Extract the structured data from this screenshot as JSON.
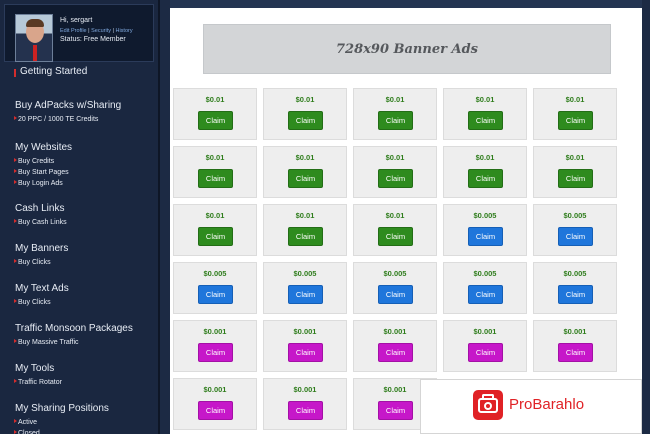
{
  "profile": {
    "greeting": "Hi, sergart",
    "links": [
      "Edit Profile",
      "Security",
      "History"
    ],
    "status": "Status: Free Member"
  },
  "menu": [
    {
      "title": "Getting Started",
      "marked": true,
      "items": []
    },
    {
      "title": "Buy AdPacks w/Sharing",
      "marked": false,
      "items": [
        "20 PPC / 1000 TE Credits"
      ]
    },
    {
      "title": "My Websites",
      "marked": false,
      "items": [
        "Buy Credits",
        "Buy Start Pages",
        "Buy Login Ads"
      ]
    },
    {
      "title": "Cash Links",
      "marked": false,
      "items": [
        "Buy Cash Links"
      ]
    },
    {
      "title": "My Banners",
      "marked": false,
      "items": [
        "Buy Clicks"
      ]
    },
    {
      "title": "My Text Ads",
      "marked": false,
      "items": [
        "Buy Clicks"
      ]
    },
    {
      "title": "Traffic Monsoon Packages",
      "marked": false,
      "items": [
        "Buy Massive Traffic"
      ]
    },
    {
      "title": "My Tools",
      "marked": false,
      "items": [
        "Traffic Rotator"
      ]
    },
    {
      "title": "My Sharing Positions",
      "marked": false,
      "items": [
        "Active",
        "Closed"
      ]
    }
  ],
  "banner": {
    "text": "728x90 Banner Ads"
  },
  "claim_label": "Claim",
  "colors": {
    "green": "#2e8b1e",
    "blue": "#1f76db",
    "magenta": "#c617c9",
    "sidebar": "#1a2740"
  },
  "ads": [
    [
      {
        "amount": "$0.01",
        "color": "green"
      },
      {
        "amount": "$0.01",
        "color": "green"
      },
      {
        "amount": "$0.01",
        "color": "green"
      },
      {
        "amount": "$0.01",
        "color": "green"
      },
      {
        "amount": "$0.01",
        "color": "green"
      }
    ],
    [
      {
        "amount": "$0.01",
        "color": "green"
      },
      {
        "amount": "$0.01",
        "color": "green"
      },
      {
        "amount": "$0.01",
        "color": "green"
      },
      {
        "amount": "$0.01",
        "color": "green"
      },
      {
        "amount": "$0.01",
        "color": "green"
      }
    ],
    [
      {
        "amount": "$0.01",
        "color": "green"
      },
      {
        "amount": "$0.01",
        "color": "green"
      },
      {
        "amount": "$0.01",
        "color": "green"
      },
      {
        "amount": "$0.005",
        "color": "blue"
      },
      {
        "amount": "$0.005",
        "color": "blue"
      }
    ],
    [
      {
        "amount": "$0.005",
        "color": "blue"
      },
      {
        "amount": "$0.005",
        "color": "blue"
      },
      {
        "amount": "$0.005",
        "color": "blue"
      },
      {
        "amount": "$0.005",
        "color": "blue"
      },
      {
        "amount": "$0.005",
        "color": "blue"
      }
    ],
    [
      {
        "amount": "$0.001",
        "color": "magenta"
      },
      {
        "amount": "$0.001",
        "color": "magenta"
      },
      {
        "amount": "$0.001",
        "color": "magenta"
      },
      {
        "amount": "$0.001",
        "color": "magenta"
      },
      {
        "amount": "$0.001",
        "color": "magenta"
      }
    ],
    [
      {
        "amount": "$0.001",
        "color": "magenta"
      },
      {
        "amount": "$0.001",
        "color": "magenta"
      },
      {
        "amount": "$0.001",
        "color": "magenta"
      }
    ]
  ],
  "watermark": {
    "text": "ProBarahlo",
    "icon": "camera-icon"
  }
}
